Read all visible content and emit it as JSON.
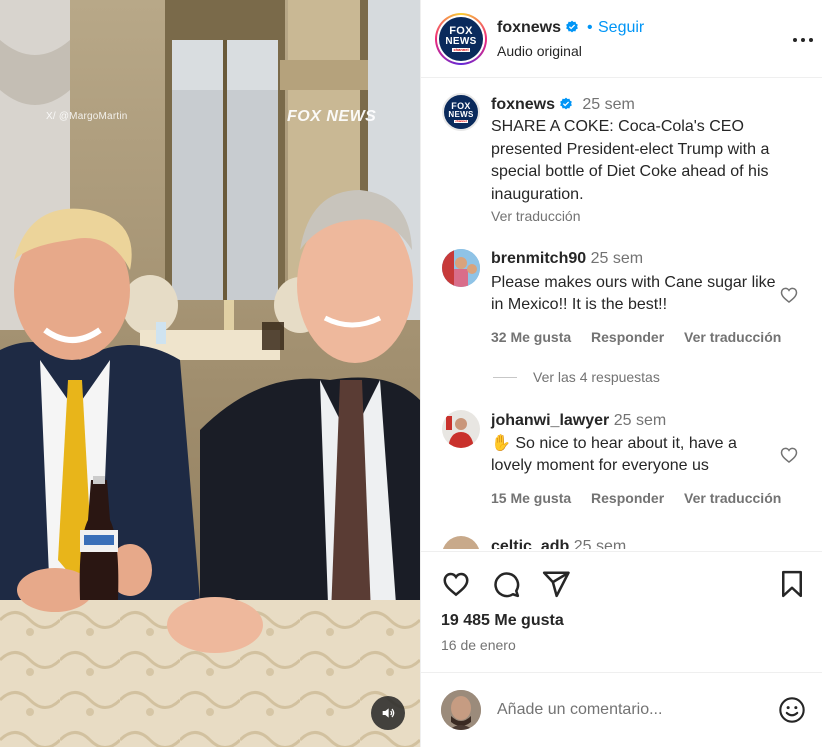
{
  "media": {
    "watermark_credit": "X/ @MargoMartin",
    "watermark_brand": "FOX NEWS",
    "mute_icon": "speaker-muted-icon"
  },
  "header": {
    "username": "foxnews",
    "separator": "•",
    "follow_label": "Seguir",
    "audio_label": "Audio original",
    "more_icon": "more-horizontal-icon",
    "avatar_logo_line1": "FOX",
    "avatar_logo_line2": "NEWS",
    "avatar_logo_line3": "channel"
  },
  "caption": {
    "username": "foxnews",
    "time": "25 sem",
    "text": "SHARE A COKE: Coca-Cola's CEO presented President-elect Trump with a special bottle of Diet Coke ahead of his inauguration.",
    "translate_label": "Ver traducción"
  },
  "comments": [
    {
      "username": "brenmitch90",
      "time": "25 sem",
      "text": "Please makes ours with Cane sugar like in Mexico!! It is the best!!",
      "likes_label": "32 Me gusta",
      "reply_label": "Responder",
      "translate_label": "Ver traducción",
      "view_replies_label": "Ver las 4 respuestas"
    },
    {
      "username": "johanwi_lawyer",
      "time": "25 sem",
      "text": "✋ So nice to hear about it, have a lovely moment for everyone us",
      "likes_label": "15 Me gusta",
      "reply_label": "Responder",
      "translate_label": "Ver traducción"
    },
    {
      "username": "celtic_adb",
      "time": "25 sem"
    }
  ],
  "actions": {
    "like_icon": "heart-icon",
    "comment_icon": "comment-icon",
    "share_icon": "send-icon",
    "save_icon": "bookmark-icon",
    "likes_label": "19 485 Me gusta",
    "date_label": "16 de enero"
  },
  "composer": {
    "placeholder": "Añade un comentario...",
    "emoji_icon": "emoji-smiley-icon"
  },
  "colors": {
    "link_blue": "#0095f6",
    "verified_blue": "#0095f6",
    "secondary_text": "#737373",
    "primary_text": "#262626",
    "divider": "#efefef"
  }
}
